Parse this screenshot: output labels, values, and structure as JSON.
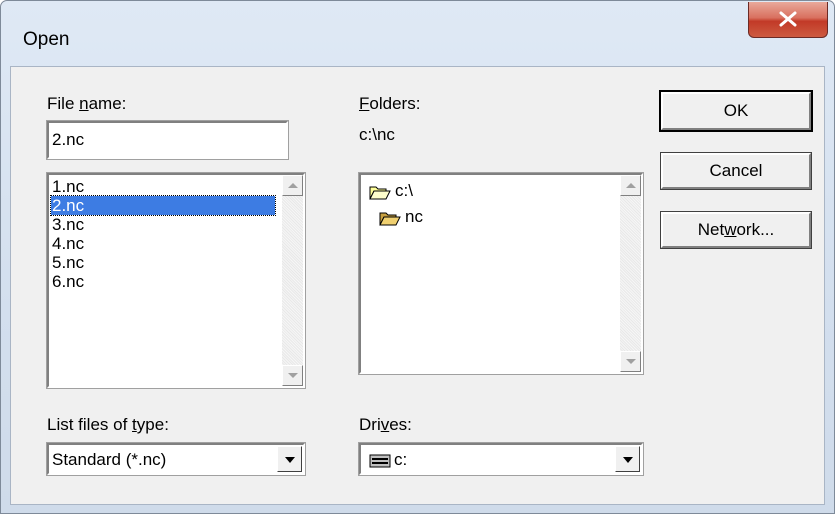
{
  "window": {
    "title": "Open"
  },
  "labels": {
    "file_name": [
      "File ",
      "n",
      "ame:"
    ],
    "folders": [
      "",
      "F",
      "olders:"
    ],
    "current_folder": "c:\\nc",
    "list_type": [
      "List files of ",
      "t",
      "ype:"
    ],
    "drives": [
      "Dri",
      "v",
      "es:"
    ]
  },
  "file_name_value": "2.nc",
  "files": [
    "1.nc",
    "2.nc",
    "3.nc",
    "4.nc",
    "5.nc",
    "6.nc"
  ],
  "selected_file": "2.nc",
  "folders": [
    {
      "name": "c:\\",
      "icon": "open-folder-icon"
    },
    {
      "name": "nc",
      "icon": "open-folder-icon"
    }
  ],
  "file_type": "Standard (*.nc)",
  "drive": {
    "value": "c:",
    "icon": "drive-icon"
  },
  "buttons": {
    "ok": "OK",
    "cancel": "Cancel",
    "network": [
      "Net",
      "w",
      "ork..."
    ]
  }
}
